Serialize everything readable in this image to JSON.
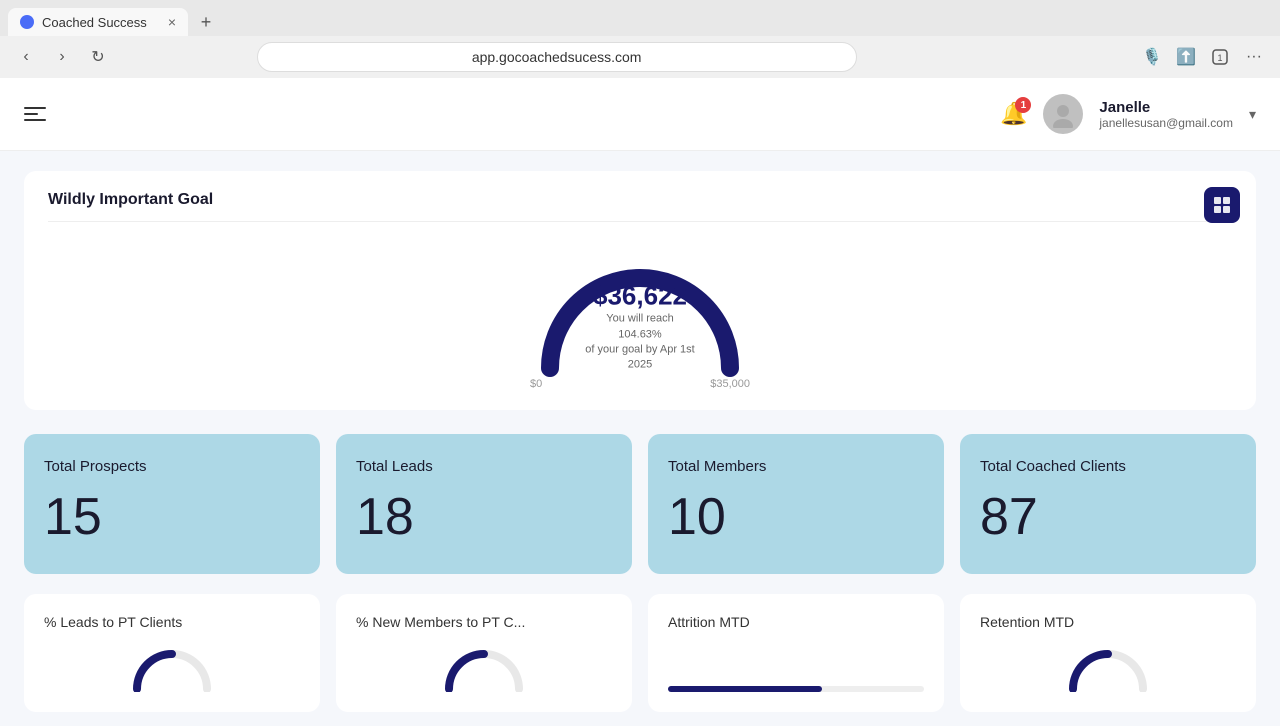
{
  "browser": {
    "tab_label": "Coached Success",
    "tab_close": "×",
    "tab_new": "+",
    "url": "app.gocoachedsucess.com",
    "nav_back": "‹",
    "nav_forward": "›",
    "nav_reload": "↻"
  },
  "header": {
    "notification_count": "1",
    "user_name": "Janelle",
    "user_email": "janellesusan@gmail.com"
  },
  "wig": {
    "title": "Wildly Important Goal",
    "amount": "$36,622",
    "sub_line1": "You will reach 104.63%",
    "sub_line2": "of your goal by Apr 1st 2025",
    "label_left": "$0",
    "label_right": "$35,000",
    "gauge_pct": 104.63
  },
  "stats": [
    {
      "label": "Total Prospects",
      "value": "15"
    },
    {
      "label": "Total Leads",
      "value": "18"
    },
    {
      "label": "Total Members",
      "value": "10"
    },
    {
      "label": "Total Coached Clients",
      "value": "87"
    }
  ],
  "bottom_cards": [
    {
      "label": "% Leads to PT Clients",
      "type": "gauge"
    },
    {
      "label": "% New Members to PT C...",
      "type": "gauge"
    },
    {
      "label": "Attrition MTD",
      "type": "bar"
    },
    {
      "label": "Retention MTD",
      "type": "gauge"
    }
  ]
}
